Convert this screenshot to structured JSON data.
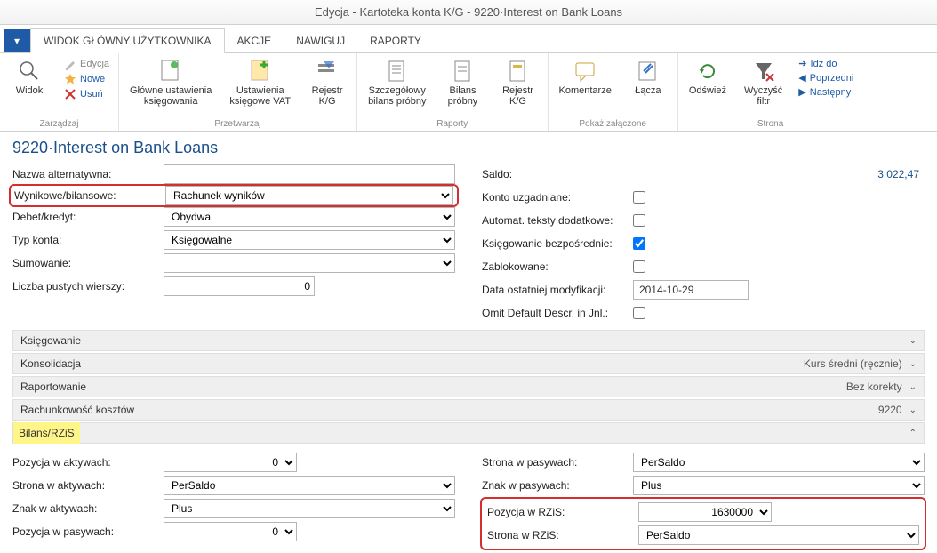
{
  "window": {
    "title": "Edycja - Kartoteka konta K/G - 9220·Interest on Bank Loans"
  },
  "tabs": {
    "file": "▼",
    "items": [
      "WIDOK GŁÓWNY UŻYTKOWNIKA",
      "AKCJE",
      "NAWIGUJ",
      "RAPORTY"
    ]
  },
  "ribbon": {
    "zarzadzaj": {
      "label": "Zarządzaj",
      "widok": "Widok",
      "edycja": "Edycja",
      "nowe": "Nowe",
      "usun": "Usuń"
    },
    "przetwarzaj": {
      "label": "Przetwarzaj",
      "glowne": "Główne ustawienia\nksięgowania",
      "vat": "Ustawienia\nksięgowe VAT",
      "rejestr": "Rejestr\nK/G"
    },
    "raporty": {
      "label": "Raporty",
      "szcz": "Szczegółowy\nbilans próbny",
      "bilans": "Bilans\npróbny",
      "rejestr": "Rejestr\nK/G"
    },
    "pokaz": {
      "label": "Pokaż załączone",
      "koment": "Komentarze",
      "lacza": "Łącza"
    },
    "strona": {
      "label": "Strona",
      "odswiez": "Odśwież",
      "wyczysc": "Wyczyść\nfiltr",
      "idz": "Idź do",
      "poprz": "Poprzedni",
      "nast": "Następny"
    }
  },
  "content_title": "9220·Interest on Bank Loans",
  "left": {
    "nazwa_label": "Nazwa alternatywna:",
    "wyn_label": "Wynikowe/bilansowe:",
    "wyn_val": "Rachunek wyników",
    "dk_label": "Debet/kredyt:",
    "dk_val": "Obydwa",
    "tk_label": "Typ konta:",
    "tk_val": "Księgowalne",
    "sum_label": "Sumowanie:",
    "lpw_label": "Liczba pustych wierszy:",
    "lpw_val": "0"
  },
  "right": {
    "saldo_label": "Saldo:",
    "saldo_val": "3 022,47",
    "ku_label": "Konto uzgadniane:",
    "atd_label": "Automat. teksty dodatkowe:",
    "kb_label": "Księgowanie bezpośrednie:",
    "zab_label": "Zablokowane:",
    "dom_label": "Data ostatniej modyfikacji:",
    "dom_val": "2014-10-29",
    "odd_label": "Omit Default Descr. in Jnl.:"
  },
  "sections": {
    "ksiegowanie": "Księgowanie",
    "konsolidacja": {
      "title": "Konsolidacja",
      "right": "Kurs średni (ręcznie)"
    },
    "raportowanie": {
      "title": "Raportowanie",
      "right": "Bez korekty"
    },
    "rachk": {
      "title": "Rachunkowość kosztów",
      "right": "9220"
    },
    "bilans": "Bilans/RZiS"
  },
  "bilans": {
    "l": {
      "pwa_label": "Pozycja w aktywach:",
      "pwa_val": "0",
      "swa_label": "Strona w aktywach:",
      "swa_val": "PerSaldo",
      "zwa_label": "Znak w aktywach:",
      "zwa_val": "Plus",
      "pwp_label": "Pozycja w pasywach:",
      "pwp_val": "0"
    },
    "r": {
      "swp_label": "Strona w pasywach:",
      "swp_val": "PerSaldo",
      "zwp_label": "Znak w pasywach:",
      "zwp_val": "Plus",
      "pwr_label": "Pozycja w RZiS:",
      "pwr_val": "1630000",
      "swr_label": "Strona w RZiS:",
      "swr_val": "PerSaldo"
    }
  }
}
